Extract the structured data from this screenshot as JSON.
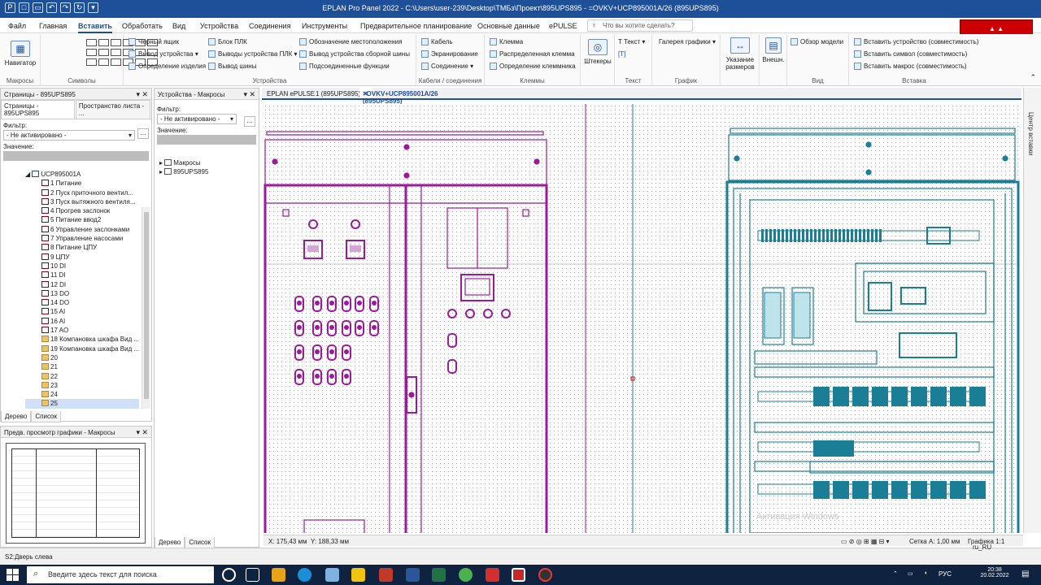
{
  "window": {
    "title": "EPLAN Pro Panel 2022 - C:\\Users\\user-239\\Desktop\\ТМБз\\Проект\\895UPS895 - =OVKV+UCP895001A/26 (895UPS895)"
  },
  "menu": {
    "tabs": [
      "Файл",
      "Главная",
      "Вставить",
      "Обработать",
      "Вид",
      "Устройства",
      "Соединения",
      "Инструменты",
      "Предварительное планирование",
      "Основные данные",
      "ePULSE"
    ],
    "search_placeholder": "Что вы хотите сделать?"
  },
  "ribbon": {
    "macros": {
      "button": "Навигатор",
      "label": "Макросы"
    },
    "symbols": {
      "label": "Символы"
    },
    "devices": {
      "label": "Устройства",
      "items": [
        "Черный ящик",
        "Вывод устройства",
        "Определение изделия",
        "Блок ПЛК",
        "Выводы устройства ПЛК",
        "Вывод шины",
        "Обозначение местоположения",
        "Вывод устройства сборной шины",
        "Подсоединенные функции"
      ]
    },
    "cables": {
      "label": "Кабели / соединения",
      "items": [
        "Кабель",
        "Экранирование",
        "Соединение"
      ]
    },
    "terminals": {
      "label": "Клеммы",
      "items": [
        "Клемма",
        "Распределенная клемма",
        "Определение клеммника"
      ]
    },
    "plugs": {
      "button": "Штекеры"
    },
    "text": {
      "button": "Текст",
      "label": "Текст"
    },
    "graphics": {
      "button": "Галерея графики",
      "label": "График"
    },
    "dims": {
      "button": "Указание размеров"
    },
    "ext": {
      "button": "Внешн."
    },
    "view": {
      "button": "Обзор модели",
      "label": "Вид"
    },
    "insert": {
      "label": "Вставка",
      "items": [
        "Вставить устройство (совместимость)",
        "Вставить символ (совместимость)",
        "Вставить макрос (совместимость)"
      ]
    }
  },
  "pages_panel": {
    "title": "Страницы - 895UPS895",
    "tabs": [
      "Страницы - 895UPS895",
      "Пространство листа - ..."
    ],
    "filter_label": "Фильтр:",
    "filter_value": "- Не активировано -",
    "value_label": "Значение:",
    "root": "UCP895001A",
    "items": [
      "1 Питание",
      "2 Пуск приточного вентил...",
      "3 Пуск вытяжного вентиля...",
      "4 Прогрев заслонок",
      "5 Питание ввод2",
      "6 Управление заслонками",
      "7 Управление насосами",
      "8 Питание ЦПУ",
      "9 ЦПУ",
      "10 DI",
      "11 DI",
      "12 DI",
      "13 DO",
      "14 DO",
      "15 AI",
      "16 AI",
      "17 AO",
      "18 Компановка шкафа Вид ...",
      "19 Компановка шкафа Вид ...",
      "20",
      "21",
      "22",
      "23",
      "24",
      "25"
    ],
    "bottom_tabs": [
      "Дерево",
      "Список"
    ]
  },
  "macros_panel": {
    "title": "Устройства - Макросы",
    "filter_label": "Фильтр:",
    "filter_value": "- Не активировано -",
    "value_label": "Значение:",
    "items": [
      "Макросы",
      "895UPS895"
    ],
    "bottom_tabs": [
      "Дерево",
      "Список"
    ]
  },
  "preview_panel": {
    "title": "Предв. просмотр графики - Макросы"
  },
  "doc_tabs": [
    "EPLAN ePULSE",
    "1 (895UPS895)",
    "=OVKV+UCP895001A/26 (895UPS895)"
  ],
  "side_tab": "Центр вставки",
  "canvas_status": {
    "x": "X: 175,43 мм",
    "y": "Y: 188,33 мм",
    "grid": "Сетка A: 1,00 мм",
    "graphic": "Графика 1:1"
  },
  "watermark": "Активация Windows",
  "status_bar": {
    "left": "S2:Дверь слева",
    "locale": "ru_RU"
  },
  "taskbar": {
    "search_placeholder": "Введите здесь текст для поиска",
    "lang": "РУС",
    "time": "20:38",
    "date": "20.02.2022"
  },
  "colors": {
    "accent": "#1e4f99",
    "door": "#9b1a9b",
    "cabinet": "#1a7f96"
  }
}
